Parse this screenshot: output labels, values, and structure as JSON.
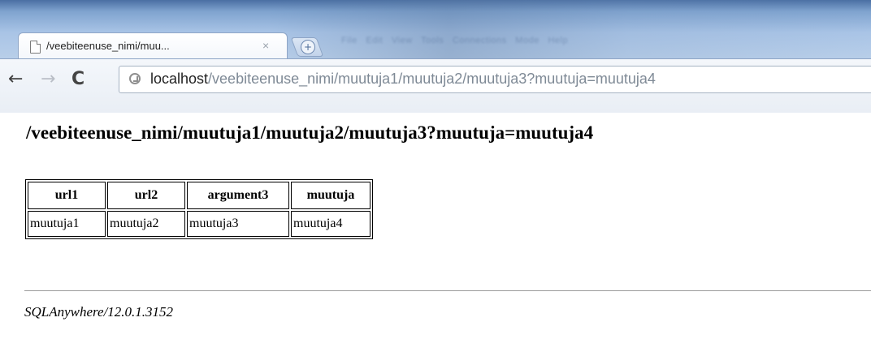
{
  "browser": {
    "tab": {
      "title": "/veebiteenuse_nimi/muu...",
      "close": "×"
    },
    "url": {
      "host": "localhost",
      "path": "/veebiteenuse_nimi/muutuja1/muutuja2/muutuja3?muutuja=muutuja4"
    }
  },
  "page": {
    "title": "/veebiteenuse_nimi/muutuja1/muutuja2/muutuja3?muutuja=muutuja4",
    "table": {
      "headers": [
        "url1",
        "url2",
        "argument3",
        "muutuja"
      ],
      "rows": [
        [
          "muutuja1",
          "muutuja2",
          "muutuja3",
          "muutuja4"
        ]
      ]
    },
    "footer": "SQLAnywhere/12.0.1.3152"
  }
}
